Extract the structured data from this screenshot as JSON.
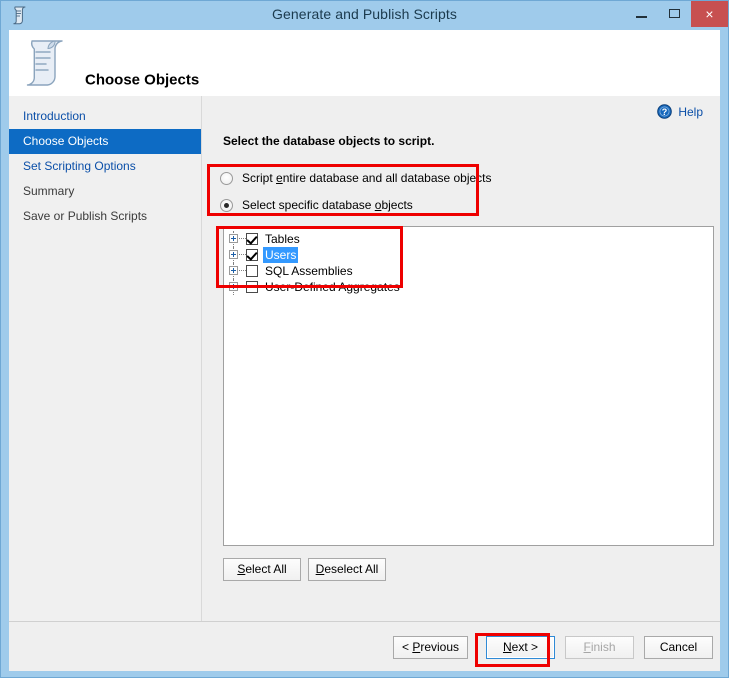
{
  "window": {
    "title": "Generate and Publish Scripts",
    "icon": "script-scroll-icon",
    "controls": {
      "minimize": "minimize-icon",
      "maximize": "maximize-icon",
      "close": "×"
    },
    "accent_titlebar": "#9fcbeb",
    "close_color": "#c75050"
  },
  "header": {
    "icon": "script-scroll-large-icon",
    "title": "Choose Objects"
  },
  "sidebar": {
    "items": [
      {
        "label": "Introduction",
        "state": "link"
      },
      {
        "label": "Choose Objects",
        "state": "selected"
      },
      {
        "label": "Set Scripting Options",
        "state": "link"
      },
      {
        "label": "Summary",
        "state": "disabled"
      },
      {
        "label": "Save or Publish Scripts",
        "state": "disabled"
      }
    ],
    "selected_bg": "#0d6bc4"
  },
  "main": {
    "help": {
      "label": "Help",
      "icon": "help-question-icon"
    },
    "instruction": "Select the database objects to script.",
    "radios": [
      {
        "pre": "Script ",
        "accel": "e",
        "post": "ntire database and all database objects",
        "checked": false
      },
      {
        "pre": "Select specific database ",
        "accel": "o",
        "post": "bjects",
        "checked": true
      }
    ],
    "tree": [
      {
        "label": "Tables",
        "checked": true,
        "selected": false
      },
      {
        "label": "Users",
        "checked": true,
        "selected": true
      },
      {
        "label": "SQL Assemblies",
        "checked": false,
        "selected": false
      },
      {
        "label": "User-Defined Aggregates",
        "checked": false,
        "selected": false
      }
    ],
    "list_buttons": [
      {
        "pre": "",
        "accel": "S",
        "post": "elect All",
        "state": "normal"
      },
      {
        "pre": "",
        "accel": "D",
        "post": "eselect All",
        "state": "normal"
      }
    ]
  },
  "footer": {
    "buttons": [
      {
        "pre": "< ",
        "accel": "P",
        "post": "revious",
        "state": "normal"
      },
      {
        "pre": "",
        "accel": "N",
        "post": "ext >",
        "state": "focused"
      },
      {
        "pre": "",
        "accel": "F",
        "post": "inish",
        "state": "disabled"
      },
      {
        "pre": "Cancel",
        "accel": "",
        "post": "",
        "state": "normal"
      }
    ]
  },
  "annotations": {
    "color": "#ee0000",
    "boxes": [
      "radio-group",
      "tree-items",
      "next-button"
    ]
  }
}
